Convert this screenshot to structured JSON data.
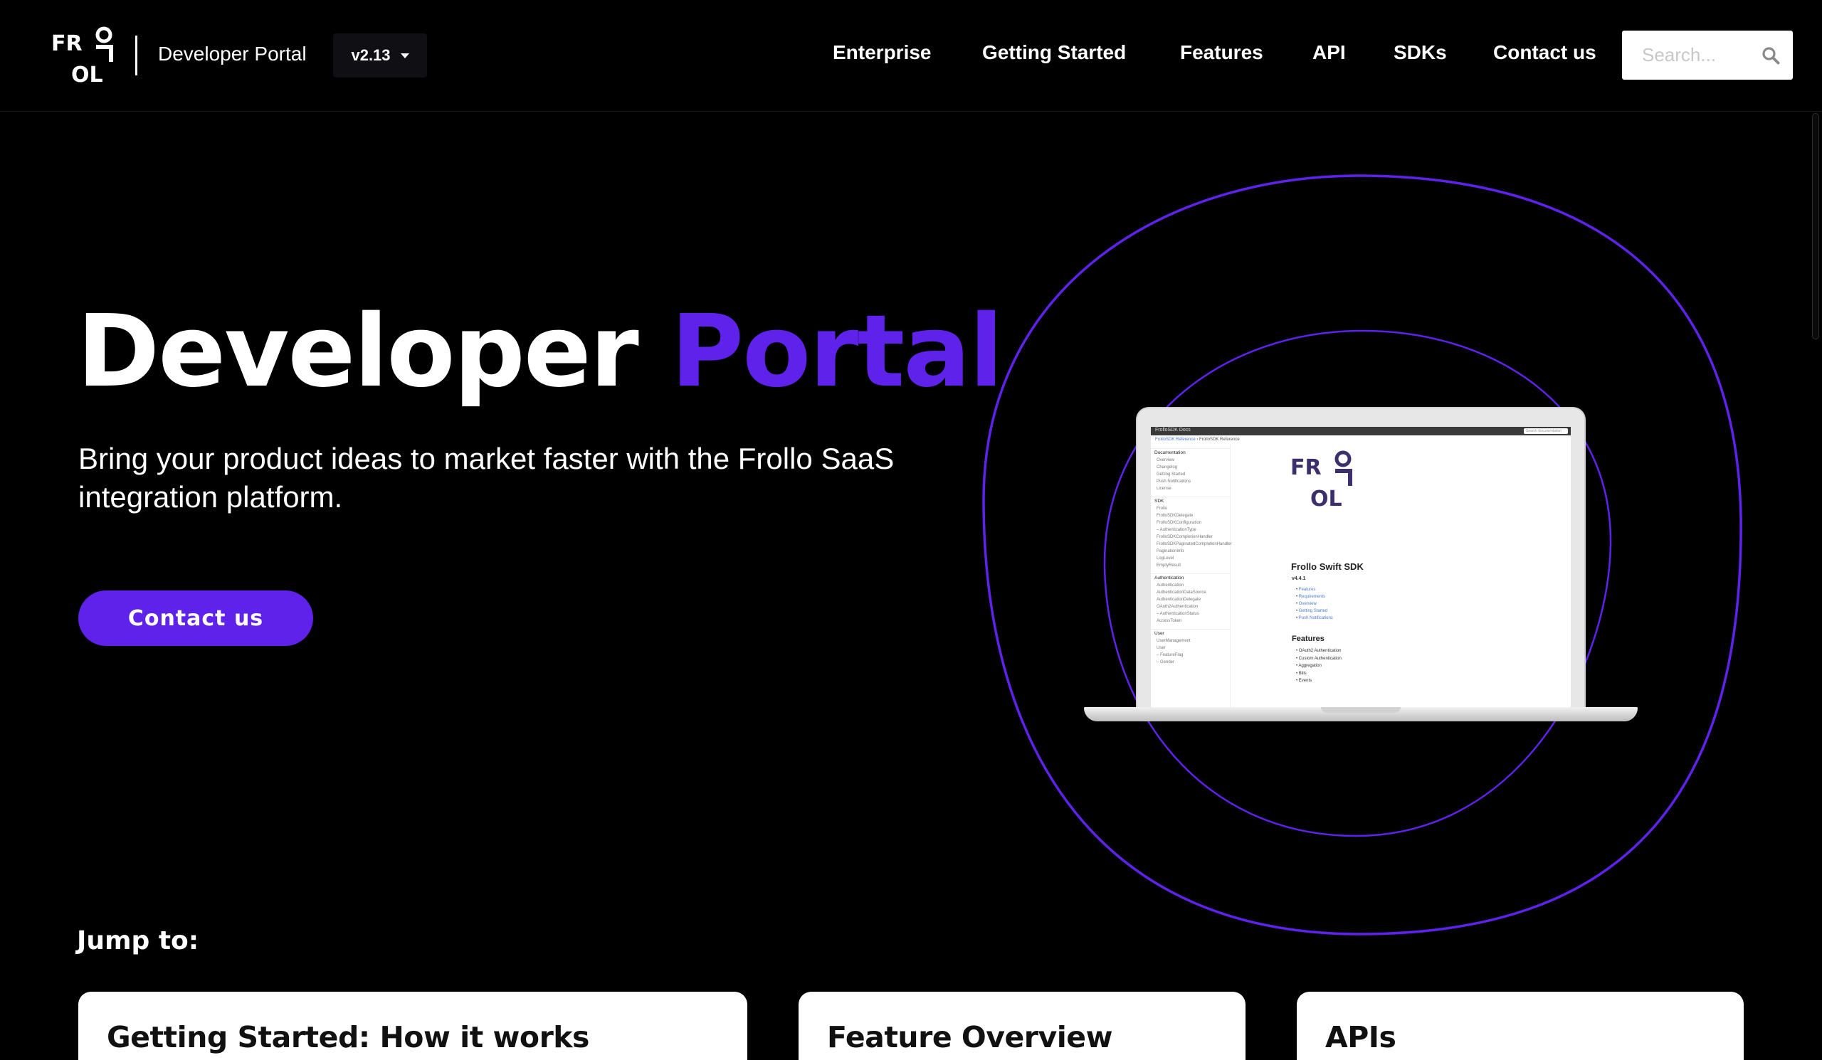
{
  "header": {
    "logo_text": "FROLLO",
    "brand_title": "Developer Portal",
    "version": "v2.13",
    "nav": [
      {
        "label": "Enterprise"
      },
      {
        "label": "Getting Started"
      },
      {
        "label": "Features"
      },
      {
        "label": "API"
      },
      {
        "label": "SDKs"
      },
      {
        "label": "Contact us"
      }
    ],
    "search_placeholder": "Search..."
  },
  "hero": {
    "title_main": "Developer",
    "title_accent": "Portal",
    "subtitle": "Bring your product ideas to market faster with the Frollo SaaS integration platform.",
    "cta_label": "Contact us",
    "accent_color": "#5f22ea"
  },
  "laptop_screen": {
    "topbar_title": "FrolloSDK Docs",
    "search_placeholder": "Search documentation",
    "breadcrumb_link": "FrolloSDK Reference",
    "breadcrumb_current": "FrolloSDK Reference",
    "sidebar": [
      {
        "head": "Documentation",
        "items": [
          "Overview",
          "Changelog",
          "Getting Started",
          "Push Notifications",
          "License"
        ]
      },
      {
        "head": "SDK",
        "items": [
          "Frollo",
          "FrolloSDKDelegate",
          "FrolloSDKConfiguration",
          "– AuthenticationType",
          "FrolloSDKCompletionHandler",
          "FrolloSDKPaginatedCompletionHandler",
          "PaginationInfo",
          "LogLevel",
          "EmptyResult"
        ]
      },
      {
        "head": "Authentication",
        "items": [
          "Authentication",
          "AuthenticationDataSource",
          "AuthenticationDelegate",
          "OAuth2Authentication",
          "– AuthenticationStatus",
          "AccessToken"
        ]
      },
      {
        "head": "User",
        "items": [
          "UserManagement",
          "User",
          "– FeatureFlag",
          "– Gender"
        ]
      }
    ],
    "sdk_title": "Frollo Swift SDK",
    "sdk_version": "v4.4.1",
    "sdk_links": [
      "Features",
      "Requirements",
      "Overview",
      "Getting Started",
      "Push Notifications"
    ],
    "features_heading": "Features",
    "features": [
      "OAuth2 Authentication",
      "Custom Authentication",
      "Aggregation",
      "Bills",
      "Events"
    ]
  },
  "jump": {
    "heading": "Jump to:",
    "cards": [
      {
        "title": "Getting Started: How it works"
      },
      {
        "title": "Feature Overview"
      },
      {
        "title": "APIs"
      }
    ]
  }
}
